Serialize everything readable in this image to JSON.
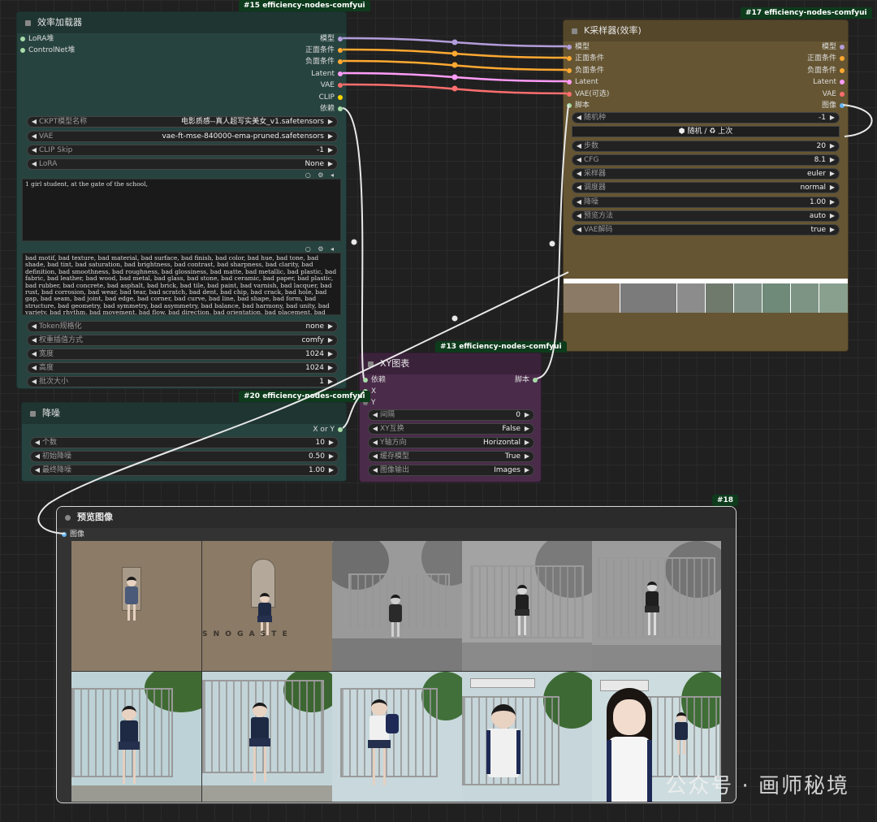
{
  "node15": {
    "badge": "#15 efficiency-nodes-comfyui",
    "title": "效率加载器",
    "inputs": [
      "LoRA堆",
      "ControlNet堆"
    ],
    "outputs": [
      "模型",
      "正面条件",
      "负面条件",
      "Latent",
      "VAE",
      "CLIP",
      "依赖"
    ],
    "widgets": [
      {
        "label": "CKPT模型名称",
        "value": "电影质感--真人超写实美女_v1.safetensors"
      },
      {
        "label": "VAE",
        "value": "vae-ft-mse-840000-ema-pruned.safetensors"
      },
      {
        "label": "CLIP Skip",
        "value": "-1"
      },
      {
        "label": "LoRA",
        "value": "None"
      }
    ],
    "positive_prompt": "1 girl student, at the gate of the school,",
    "negative_prompt": "bad motif, bad texture, bad material, bad surface, bad finish, bad color, bad hue, bad tone, bad shade, bad tint, bad saturation, bad brightness, bad contrast, bad sharpness, bad clarity, bad definition, bad smoothness, bad roughness, bad glossiness, bad matte, bad metallic, bad plastic, bad fabric, bad leather, bad wood, bad metal, bad glass, bad stone, bad ceramic, bad paper, bad plastic, bad rubber, bad concrete, bad asphalt, bad brick, bad tile, bad paint, bad varnish, bad lacquer, bad rust, bad corrosion, bad wear, bad tear, bad scratch, bad dent, bad chip, bad crack, bad hole, bad gap, bad seam, bad joint, bad edge, bad corner, bad curve, bad line, bad shape, bad form, bad structure, bad geometry, bad symmetry, bad asymmetry, bad balance, bad harmony, bad unity, bad variety, bad rhythm, bad movement, bad flow, bad direction, bad orientation, bad placement, bad alignment, bad spacing, bad repetition, bad pattern, bad motif, bad texture, bad material, bad",
    "widgets2": [
      {
        "label": "Token规格化",
        "value": "none"
      },
      {
        "label": "权重插值方式",
        "value": "comfy"
      },
      {
        "label": "宽度",
        "value": "1024"
      },
      {
        "label": "高度",
        "value": "1024"
      },
      {
        "label": "批次大小",
        "value": "1"
      }
    ]
  },
  "node20": {
    "badge": "#20 efficiency-nodes-comfyui",
    "title": "降噪",
    "outputs": [
      "X or Y"
    ],
    "widgets": [
      {
        "label": "个数",
        "value": "10"
      },
      {
        "label": "初始降噪",
        "value": "0.50"
      },
      {
        "label": "最终降噪",
        "value": "1.00"
      }
    ]
  },
  "node13": {
    "badge": "#13 efficiency-nodes-comfyui",
    "title": "XY图表",
    "inputs": [
      "依赖",
      "X",
      "Y"
    ],
    "outputs": [
      "脚本"
    ],
    "widgets": [
      {
        "label": "间隔",
        "value": "0"
      },
      {
        "label": "XY互换",
        "value": "False"
      },
      {
        "label": "Y轴方向",
        "value": "Horizontal"
      },
      {
        "label": "缓存模型",
        "value": "True"
      },
      {
        "label": "图像输出",
        "value": "Images"
      }
    ]
  },
  "node17": {
    "badge": "#17 efficiency-nodes-comfyui",
    "title": "K采样器(效率)",
    "inputs": [
      "模型",
      "正面条件",
      "负面条件",
      "Latent",
      "VAE(可选)",
      "脚本"
    ],
    "outputs": [
      "模型",
      "正面条件",
      "负面条件",
      "Latent",
      "VAE",
      "图像"
    ],
    "seed": {
      "label": "随机种",
      "value": "-1"
    },
    "seed_button": "随机 / ♻ 上次",
    "widgets": [
      {
        "label": "步数",
        "value": "20"
      },
      {
        "label": "CFG",
        "value": "8.1"
      },
      {
        "label": "采样器",
        "value": "euler"
      },
      {
        "label": "调度器",
        "value": "normal"
      },
      {
        "label": "降噪",
        "value": "1.00"
      },
      {
        "label": "预览方法",
        "value": "auto"
      },
      {
        "label": "VAE解码",
        "value": "true"
      }
    ]
  },
  "node18": {
    "badge": "#18",
    "title": "预览图像",
    "inputs": [
      "图像"
    ]
  },
  "watermark": "公众号 · 画师秘境",
  "colors": {
    "model": "#b39ddb",
    "conditioning": "#ffa931",
    "latent": "#ff9cf9",
    "vae": "#ff6e6e",
    "clip": "#ffd500",
    "dep": "#a8dba8",
    "image": "#64b5f6"
  }
}
